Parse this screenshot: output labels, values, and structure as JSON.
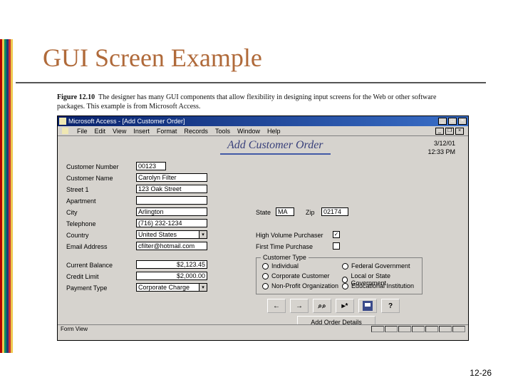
{
  "slide": {
    "title": "GUI Screen Example",
    "page_number": "12-26"
  },
  "caption": {
    "label": "Figure 12.10",
    "text": "The designer has many GUI components that allow flexibility in designing input screens for the Web or other software packages. This example is from Microsoft Access."
  },
  "app": {
    "title": "Microsoft Access - [Add Customer Order]",
    "menus": [
      "File",
      "Edit",
      "View",
      "Insert",
      "Format",
      "Records",
      "Tools",
      "Window",
      "Help"
    ],
    "form_title": "Add Customer Order",
    "date": "3/12/01",
    "time": "12:33 PM",
    "status": "Form View"
  },
  "fields": {
    "customer_number": {
      "label": "Customer Number",
      "value": "00123"
    },
    "customer_name": {
      "label": "Customer Name",
      "value": "Carolyn Filter"
    },
    "street1": {
      "label": "Street 1",
      "value": "123 Oak Street"
    },
    "apartment": {
      "label": "Apartment",
      "value": ""
    },
    "city": {
      "label": "City",
      "value": "Arlington"
    },
    "state": {
      "label": "State",
      "value": "MA"
    },
    "zip": {
      "label": "Zip",
      "value": "02174"
    },
    "telephone": {
      "label": "Telephone",
      "value": "(716) 232-1234"
    },
    "country": {
      "label": "Country",
      "value": "United States"
    },
    "email": {
      "label": "Email Address",
      "value": "cfilter@hotmail.com"
    },
    "high_volume": {
      "label": "High Volume Purchaser",
      "checked": true
    },
    "first_time": {
      "label": "First Time Purchase",
      "checked": false
    },
    "current_balance": {
      "label": "Current Balance",
      "value": "$2,123.45"
    },
    "credit_limit": {
      "label": "Credit Limit",
      "value": "$2,000.00"
    },
    "payment_type": {
      "label": "Payment Type",
      "value": "Corporate Charge"
    }
  },
  "customer_type": {
    "title": "Customer Type",
    "options": [
      "Individual",
      "Corporate Customer",
      "Non-Profit Organization",
      "Federal Government",
      "Local or State Government",
      "Educational Institution"
    ]
  },
  "buttons": {
    "add_details": "Add Order Details"
  }
}
